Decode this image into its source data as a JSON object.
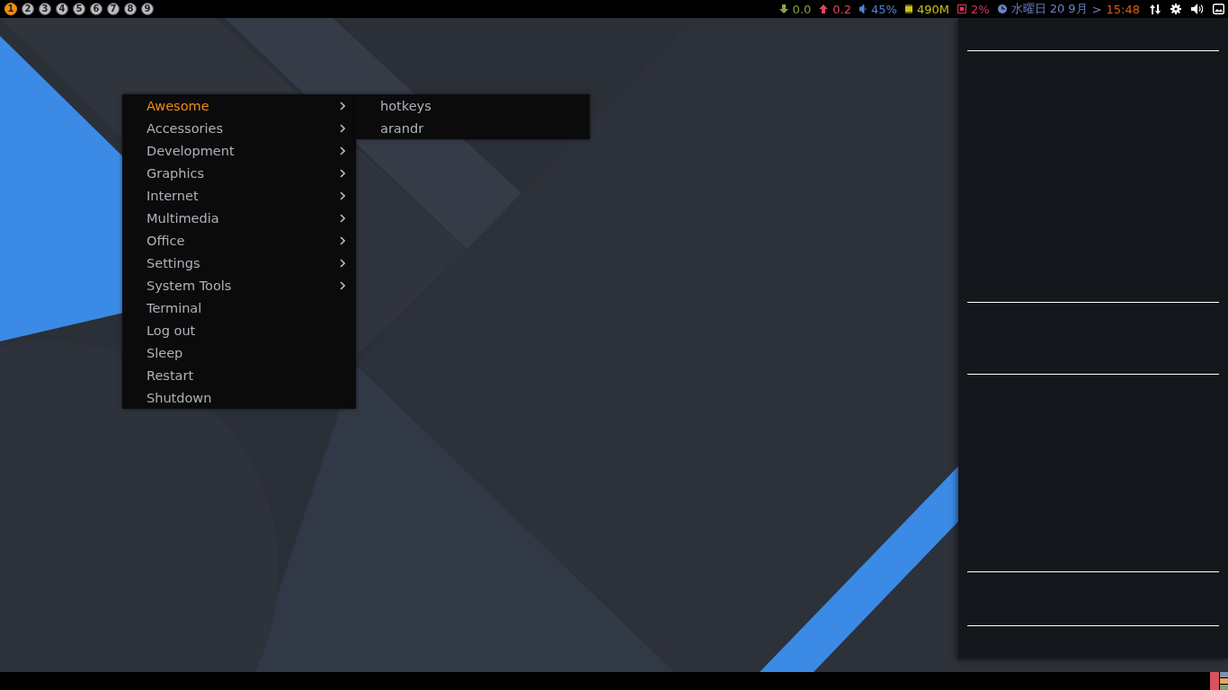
{
  "top_bar": {
    "tags": [
      {
        "label": "1",
        "selected": true
      },
      {
        "label": "2",
        "selected": false
      },
      {
        "label": "3",
        "selected": false
      },
      {
        "label": "4",
        "selected": false
      },
      {
        "label": "5",
        "selected": false
      },
      {
        "label": "6",
        "selected": false
      },
      {
        "label": "7",
        "selected": false
      },
      {
        "label": "8",
        "selected": false
      },
      {
        "label": "9",
        "selected": false
      }
    ],
    "widgets": [
      {
        "kind": "net-down",
        "text": "0.0",
        "color": "#87a64a"
      },
      {
        "kind": "net-up",
        "text": "0.2",
        "color": "#e0475e"
      },
      {
        "kind": "volume",
        "text": "45%",
        "color": "#4f86d8"
      },
      {
        "kind": "memory",
        "text": "490M",
        "color": "#c7c41c"
      },
      {
        "kind": "cpu",
        "text": "2%",
        "color": "#e0335f"
      },
      {
        "kind": "clock",
        "text": "水曜日 20 9月",
        "color": "#6b83c9"
      }
    ],
    "clock_separator": ">",
    "time": "15:48",
    "tray": [
      {
        "kind": "network"
      },
      {
        "kind": "settings"
      },
      {
        "kind": "volume"
      },
      {
        "kind": "screen"
      }
    ]
  },
  "menu": {
    "items": [
      {
        "label": "Awesome",
        "submenu": true,
        "selected": true
      },
      {
        "label": "Accessories",
        "submenu": true,
        "selected": false
      },
      {
        "label": "Development",
        "submenu": true,
        "selected": false
      },
      {
        "label": "Graphics",
        "submenu": true,
        "selected": false
      },
      {
        "label": "Internet",
        "submenu": true,
        "selected": false
      },
      {
        "label": "Multimedia",
        "submenu": true,
        "selected": false
      },
      {
        "label": "Office",
        "submenu": true,
        "selected": false
      },
      {
        "label": "Settings",
        "submenu": true,
        "selected": false
      },
      {
        "label": "System Tools",
        "submenu": true,
        "selected": false
      },
      {
        "label": "Terminal",
        "submenu": false,
        "selected": false
      },
      {
        "label": "Log out",
        "submenu": false,
        "selected": false
      },
      {
        "label": "Sleep",
        "submenu": false,
        "selected": false
      },
      {
        "label": "Restart",
        "submenu": false,
        "selected": false
      },
      {
        "label": "Shutdown",
        "submenu": false,
        "selected": false
      }
    ],
    "submenu": [
      {
        "label": "hotkeys",
        "selected": false
      },
      {
        "label": "arandr",
        "selected": false
      }
    ]
  },
  "bottom_bar": {
    "layout_icon": {
      "kind": "tile"
    }
  }
}
